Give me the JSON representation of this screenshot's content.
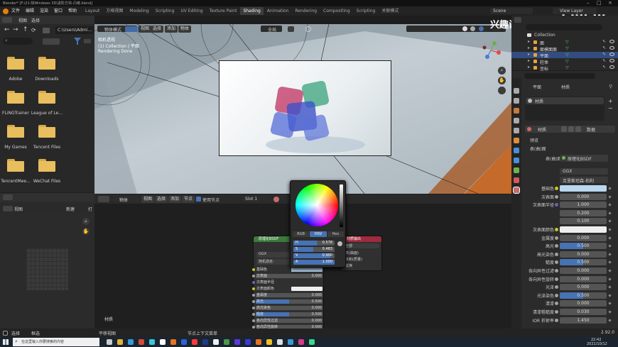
{
  "window": {
    "title": "Blender* [F:\\21-快Windows 3D\\进阶方块-凸嚎.blend]"
  },
  "topbar": {
    "menu": [
      "文件",
      "编辑",
      "渲染",
      "窗口",
      "帮助"
    ],
    "workspaces": [
      "Layout",
      "方格视图",
      "Modeling",
      "Scripting",
      "UV Editing",
      "Texture Paint",
      "Shading",
      "Animation",
      "Rendering",
      "Compositing",
      "Scripting",
      "关联模式"
    ],
    "active_workspace": "Shading",
    "scene": "Scene",
    "view_layer": "View Layer"
  },
  "watermark": {
    "text": "兴趣设计师k",
    "logo": "bilibili"
  },
  "filebrowser": {
    "header": [
      "视图",
      "选择"
    ],
    "path": "C:\\Users\\Admin...",
    "items": [
      "Adobe",
      "Downloads",
      "FLiNGTrainer",
      "League of Le...",
      "My Games",
      "Tencent Files",
      "TencentMee...",
      "WeChat Files"
    ]
  },
  "imageeditor": {
    "header": [
      "视图",
      "新建",
      "打"
    ]
  },
  "viewport": {
    "header": [
      "物体模式",
      "视图",
      "选择",
      "添加",
      "物体"
    ],
    "transform": "全局",
    "info": [
      "相机透视",
      "(1) Collection | 平面",
      "Rendering Done"
    ]
  },
  "nodeeditor": {
    "header": [
      "物体",
      "视图",
      "选择",
      "添加",
      "节点"
    ],
    "use_nodes": "使用节点",
    "slot": "Slot 1",
    "material_label": "材质"
  },
  "colorpicker": {
    "tabs": [
      "RGB",
      "HSV",
      "Hex"
    ],
    "active_tab": "HSV",
    "fields": [
      {
        "label": "H",
        "value": "0.578"
      },
      {
        "label": "S",
        "value": "0.483"
      },
      {
        "label": "V",
        "value": "0.900"
      },
      {
        "label": "A",
        "value": "1.000"
      }
    ]
  },
  "bsdf_node": {
    "title": "原理化BSDF",
    "dist": "GGX",
    "sss": "随机游走-",
    "rows": [
      {
        "label": "基础色",
        "value": ""
      },
      {
        "label": "次表面",
        "value": "0.000"
      },
      {
        "label": "次表面半径",
        "value": ""
      },
      {
        "label": "次表面颜色",
        "value": ""
      },
      {
        "label": "金属度",
        "value": "0.000"
      },
      {
        "label": "高光",
        "value": "0.500"
      },
      {
        "label": "高光染色",
        "value": "0.000"
      },
      {
        "label": "糙度",
        "value": "0.500"
      },
      {
        "label": "各向异性过滤",
        "value": "0.000"
      },
      {
        "label": "各向异性旋转",
        "value": "0.000"
      }
    ]
  },
  "output_node": {
    "title": "材质输出",
    "target": "全部",
    "rows": [
      "表(曲面)",
      "体积(质量)",
      "置换"
    ]
  },
  "outliner": {
    "collection": "Collection",
    "items": [
      "面",
      "面模面面",
      "平面",
      "柱体",
      "坐标"
    ]
  },
  "properties": {
    "object": "平面",
    "tab": "材质",
    "slot": "材质",
    "material_name": "材质",
    "link": "数据",
    "sections": [
      "预览",
      "表(曲)面"
    ],
    "surface": "原理化BSDF",
    "distribution": "GGX",
    "sss_method": "克里斯坦森-伯利",
    "rows": [
      {
        "label": "基础色",
        "value": "",
        "kind": "color"
      },
      {
        "label": "次表面",
        "value": "0.000",
        "kind": "num"
      },
      {
        "label": "次表面半径",
        "value": "1.000",
        "kind": "num"
      },
      {
        "label": "",
        "value": "0.200",
        "kind": "num"
      },
      {
        "label": "",
        "value": "0.100",
        "kind": "num"
      },
      {
        "label": "次表面颜色",
        "value": "",
        "kind": "color"
      },
      {
        "label": "金属度",
        "value": "0.000",
        "kind": "num"
      },
      {
        "label": "高光",
        "value": "0.500",
        "kind": "blue"
      },
      {
        "label": "高光染色",
        "value": "0.000",
        "kind": "num"
      },
      {
        "label": "糙度",
        "value": "0.500",
        "kind": "blue"
      },
      {
        "label": "各向异性过滤",
        "value": "0.000",
        "kind": "num"
      },
      {
        "label": "各向异性旋转",
        "value": "0.000",
        "kind": "num"
      },
      {
        "label": "光泽",
        "value": "0.000",
        "kind": "num"
      },
      {
        "label": "光泽染色",
        "value": "0.500",
        "kind": "blue"
      },
      {
        "label": "清漆",
        "value": "0.000",
        "kind": "num"
      },
      {
        "label": "清漆粗糙度",
        "value": "0.030",
        "kind": "num"
      },
      {
        "label": "IOR 折射率",
        "value": "1.450",
        "kind": "num"
      }
    ]
  },
  "statusbar": {
    "left": [
      "选择",
      "框选",
      "平移视图",
      "节点上下文菜单"
    ],
    "version": "2.92.0",
    "search_placeholder": "在这里输入你要搜索的内容",
    "time": "22:42",
    "date": "2021/10/12"
  },
  "colors": {
    "accent": "#4772b3",
    "bg": "#1d1d1d",
    "panel": "#303030",
    "header": "#242424"
  }
}
